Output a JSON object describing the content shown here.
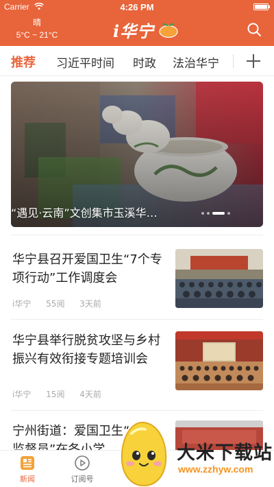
{
  "status_bar": {
    "carrier": "Carrier",
    "time": "4:26 PM"
  },
  "header": {
    "weather_condition": "晴",
    "weather_temp": "5°C ~ 21°C",
    "logo_text": "i华宁",
    "accent_color": "#e8643a"
  },
  "tabs": [
    {
      "label": "推荐",
      "active": true
    },
    {
      "label": "习近平时间",
      "active": false
    },
    {
      "label": "时政",
      "active": false
    },
    {
      "label": "法治华宁",
      "active": false
    }
  ],
  "hero": {
    "caption": "“遇见·云南”文创集市玉溪华…",
    "slide_count": 4,
    "active_slide": 3
  },
  "news": [
    {
      "title": "华宁县召开爱国卫生“7个专项行动”工作调度会",
      "source": "i华宁",
      "views": "55阅",
      "time": "3天前"
    },
    {
      "title": "华宁县举行脱贫攻坚与乡村振兴有效衔接专题培训会",
      "source": "i华宁",
      "views": "15阅",
      "time": "4天前"
    },
    {
      "title": "宁州街道：爱国卫生“小小监督员”在各小学…",
      "source": "",
      "views": "",
      "time": ""
    }
  ],
  "bottom_nav": [
    {
      "label": "新闻",
      "active": true,
      "icon": "news-icon"
    },
    {
      "label": "订阅号",
      "active": false,
      "icon": "subscribe-icon"
    }
  ],
  "watermark": {
    "title": "大米下载站",
    "url": "www.zzhyw.com"
  }
}
